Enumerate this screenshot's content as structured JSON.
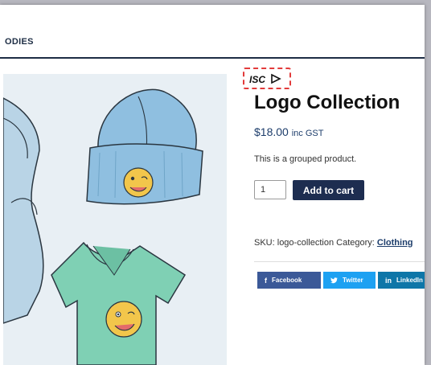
{
  "nav": {
    "item_partial": "ODIES"
  },
  "product": {
    "badge_text": "ISC",
    "title": "Logo Collection",
    "price": "$18.00",
    "tax_note": "inc GST",
    "description": "This is a grouped product.",
    "quantity": "1",
    "add_to_cart_label": "Add to cart",
    "sku_label": "SKU:",
    "sku_value": "logo-collection",
    "category_label": "Category:",
    "category_value": "Clothing"
  },
  "share": {
    "facebook_label": "Facebook",
    "twitter_label": "Twitter",
    "linkedin_label": "LinkedIn"
  },
  "colors": {
    "accent": "#1d2d50",
    "badge_border": "#e23b3b",
    "facebook": "#3b5998",
    "twitter": "#1da1f2",
    "linkedin": "#0e76a8"
  }
}
